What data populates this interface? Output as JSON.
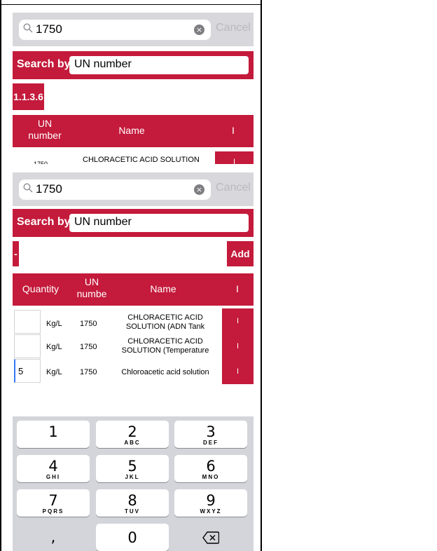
{
  "top_panel": {
    "search": {
      "value": "1750",
      "clear_glyph": "×",
      "cancel": "Cancel"
    },
    "search_by": {
      "label": "Search by",
      "value": "UN number"
    },
    "section_chip": "1.1.3.6",
    "columns": [
      "UN number",
      "Name",
      "I"
    ],
    "row": {
      "un": "1750",
      "name": "CHLORACETIC ACID SOLUTION",
      "button": "I"
    }
  },
  "bottom_panel": {
    "search": {
      "value": "1750",
      "clear_glyph": "×",
      "cancel": "Cancel"
    },
    "search_by": {
      "label": "Search by",
      "value": "UN number"
    },
    "minus_button": "-",
    "add_button": "Add",
    "columns": [
      "Quantity",
      "UN numbe",
      "Name",
      "I"
    ],
    "rows": [
      {
        "qty": "",
        "unit": "Kg/L",
        "un": "1750",
        "name": "CHLORACETIC ACID SOLUTION (ADN Tank",
        "button": "I"
      },
      {
        "qty": "",
        "unit": "Kg/L",
        "un": "1750",
        "name": "CHLORACETIC ACID SOLUTION (Temperature",
        "button": "I"
      },
      {
        "qty": "5",
        "unit": "Kg/L",
        "un": "1750",
        "name": "Chloroacetic acid solution",
        "button": "I"
      }
    ]
  },
  "keyboard": {
    "keys": [
      {
        "num": "1",
        "letters": ""
      },
      {
        "num": "2",
        "letters": "ABC"
      },
      {
        "num": "3",
        "letters": "DEF"
      },
      {
        "num": "4",
        "letters": "GHI"
      },
      {
        "num": "5",
        "letters": "JKL"
      },
      {
        "num": "6",
        "letters": "MNO"
      },
      {
        "num": "7",
        "letters": "PQRS"
      },
      {
        "num": "8",
        "letters": "TUV"
      },
      {
        "num": "9",
        "letters": "WXYZ"
      },
      {
        "num": ",",
        "letters": ""
      },
      {
        "num": "0",
        "letters": ""
      },
      {
        "num": "⌫",
        "letters": ""
      }
    ]
  },
  "colors": {
    "accent": "#c41a3b",
    "searchbar": "#d7d7dc",
    "keyboard_bg": "#d3d5da"
  }
}
